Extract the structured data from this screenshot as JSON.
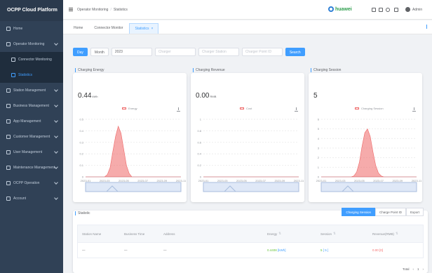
{
  "app": {
    "title": "OCPP Cloud Platform"
  },
  "sidebar": {
    "items": [
      {
        "label": "Home",
        "icon": "home-icon"
      },
      {
        "label": "Operator Monitoring",
        "icon": "monitor-icon",
        "expandable": true
      },
      {
        "label": "Connector Monitoring",
        "icon": "plug-icon",
        "sub": true
      },
      {
        "label": "Statistics",
        "icon": "chart-icon",
        "sub": true,
        "active": true
      },
      {
        "label": "Station Management",
        "icon": "station-icon",
        "expandable": true
      },
      {
        "label": "Business Management",
        "icon": "briefcase-icon",
        "expandable": true
      },
      {
        "label": "App Management",
        "icon": "app-icon",
        "expandable": true
      },
      {
        "label": "Customer Management",
        "icon": "customer-icon",
        "expandable": true
      },
      {
        "label": "User Management",
        "icon": "user-icon",
        "expandable": true
      },
      {
        "label": "Maintenance Management",
        "icon": "wrench-icon",
        "expandable": true
      },
      {
        "label": "OCPP Operation",
        "icon": "cog-icon",
        "expandable": true
      },
      {
        "label": "Account",
        "icon": "account-icon",
        "expandable": true
      }
    ]
  },
  "header": {
    "breadcrumb": [
      "Operator Monitoring",
      "Statistics"
    ],
    "logo_text": "huawei",
    "user_name": "Admin"
  },
  "tags": [
    {
      "label": "Home"
    },
    {
      "label": "Connector Monitor"
    },
    {
      "label": "Statistics",
      "active": true,
      "close": "×"
    }
  ],
  "filters": {
    "buttons": [
      "Day",
      "Month"
    ],
    "inputs": [
      {
        "value": "2023",
        "placeholder": ""
      },
      {
        "value": "",
        "placeholder": "Charger"
      },
      {
        "value": "",
        "placeholder": "Charger Station"
      },
      {
        "value": "",
        "placeholder": "Charger Point ID"
      }
    ],
    "search_label": "Search"
  },
  "cards": [
    {
      "title": "Charging Energy",
      "value": "0.44",
      "unit": "kWh",
      "legend": "Energy"
    },
    {
      "title": "Charging Revenue",
      "value": "0.00",
      "unit": "RMB",
      "legend": "Cost"
    },
    {
      "title": "Charging Session",
      "value": "5",
      "unit": "",
      "legend": "Charging Session"
    }
  ],
  "table": {
    "title": "Statistic",
    "tabs": [
      {
        "label": "Charging Session",
        "active": true
      },
      {
        "label": "Charge Point ID"
      },
      {
        "label": "Export"
      }
    ],
    "headers": [
      "Station Name",
      "Business Time",
      "Address",
      "Energy",
      "Session",
      "Revenue(RMB)"
    ],
    "row": [
      "—",
      "—",
      "—",
      "0.4408",
      "5",
      "0.00"
    ],
    "row_suffix": [
      "[kWh]",
      "[ 5 ]",
      "[0]"
    ],
    "pager": {
      "total": "Total",
      "prev": "‹",
      "page": "1",
      "next": "›"
    }
  },
  "chart_data": [
    {
      "type": "area",
      "title": "Charging Energy",
      "series": [
        {
          "name": "Energy",
          "values": [
            0,
            0,
            0,
            0,
            0,
            0,
            0,
            0,
            0.02,
            0.08,
            0.22,
            0.35,
            0.44,
            0.38,
            0.24,
            0.1,
            0.03,
            0,
            0,
            0,
            0,
            0,
            0,
            0,
            0,
            0,
            0,
            0,
            0,
            0,
            0,
            0,
            0,
            0,
            0,
            0
          ]
        }
      ],
      "ylim": [
        0,
        0.5
      ],
      "yticks": [
        "0.5",
        "0.4",
        "0.3",
        "0.2",
        "0.1",
        "0"
      ],
      "xticks": [
        "2023-01",
        "2023-03",
        "2023-05",
        "2023-07",
        "2023-09",
        "2023-11"
      ]
    },
    {
      "type": "area",
      "title": "Charging Revenue",
      "series": [
        {
          "name": "Cost",
          "values": [
            0,
            0,
            0,
            0,
            0,
            0,
            0,
            0,
            0,
            0,
            0,
            0,
            0,
            0,
            0,
            0,
            0,
            0,
            0,
            0,
            0,
            0,
            0,
            0,
            0,
            0,
            0,
            0,
            0,
            0,
            0,
            0,
            0,
            0,
            0,
            0
          ]
        }
      ],
      "ylim": [
        0,
        1
      ],
      "yticks": [
        "1",
        "0.8",
        "0.6",
        "0.4",
        "0.2",
        "0"
      ],
      "xticks": [
        "2023-01",
        "2023-03",
        "2023-05",
        "2023-07",
        "2023-09",
        "2023-11"
      ]
    },
    {
      "type": "area",
      "title": "Charging Session",
      "series": [
        {
          "name": "Charging Session",
          "values": [
            0,
            0,
            0,
            0,
            0,
            0,
            0,
            0,
            0,
            0,
            0,
            0,
            0.1,
            0.5,
            1.5,
            3.2,
            4.6,
            5,
            4.2,
            2.6,
            1.2,
            0.4,
            0.1,
            0,
            0,
            0,
            0,
            0,
            0,
            0,
            0,
            0,
            0,
            0,
            0,
            0
          ]
        }
      ],
      "ylim": [
        0,
        6
      ],
      "yticks": [
        "6",
        "5",
        "4",
        "3",
        "2",
        "1",
        "0"
      ],
      "xticks": [
        "2023-01",
        "2023-03",
        "2023-05",
        "2023-07",
        "2023-09",
        "2023-11"
      ]
    }
  ],
  "colors": {
    "accent": "#409eff",
    "series": "#ee6666",
    "sidebar": "#304156"
  }
}
